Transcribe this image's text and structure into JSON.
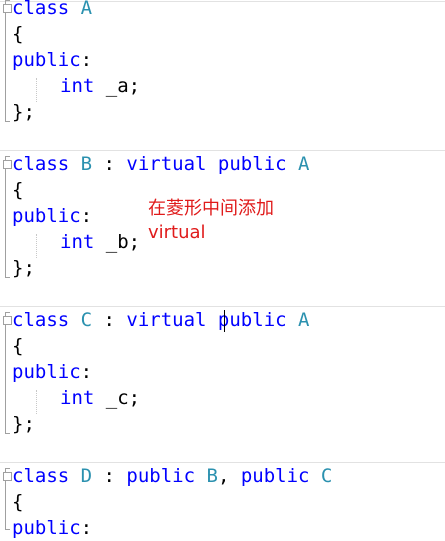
{
  "editor": {
    "lines": [
      {
        "parts": [
          {
            "t": "class ",
            "c": "kw"
          },
          {
            "t": "A",
            "c": "ty"
          }
        ]
      },
      {
        "parts": [
          {
            "t": "{",
            "c": ""
          }
        ]
      },
      {
        "parts": [
          {
            "t": "public",
            "c": "kw"
          },
          {
            "t": ":",
            "c": ""
          }
        ]
      },
      {
        "indent": true,
        "parts": [
          {
            "t": "int",
            "c": "kw"
          },
          {
            "t": " _a;",
            "c": ""
          }
        ]
      },
      {
        "parts": [
          {
            "t": "};",
            "c": ""
          }
        ]
      },
      {
        "parts": []
      },
      {
        "parts": [
          {
            "t": "class ",
            "c": "kw"
          },
          {
            "t": "B",
            "c": "ty"
          },
          {
            "t": " : ",
            "c": ""
          },
          {
            "t": "virtual public ",
            "c": "kw"
          },
          {
            "t": "A",
            "c": "ty"
          }
        ]
      },
      {
        "parts": [
          {
            "t": "{",
            "c": ""
          }
        ]
      },
      {
        "parts": [
          {
            "t": "public",
            "c": "kw"
          },
          {
            "t": ":",
            "c": ""
          }
        ]
      },
      {
        "indent": true,
        "parts": [
          {
            "t": "int",
            "c": "kw"
          },
          {
            "t": " _b;",
            "c": ""
          }
        ]
      },
      {
        "parts": [
          {
            "t": "};",
            "c": ""
          }
        ]
      },
      {
        "parts": []
      },
      {
        "parts": [
          {
            "t": "class ",
            "c": "kw"
          },
          {
            "t": "C",
            "c": "ty"
          },
          {
            "t": " : ",
            "c": ""
          },
          {
            "t": "virtual public ",
            "c": "kw"
          },
          {
            "t": "A",
            "c": "ty"
          }
        ]
      },
      {
        "parts": [
          {
            "t": "{",
            "c": ""
          }
        ]
      },
      {
        "parts": [
          {
            "t": "public",
            "c": "kw"
          },
          {
            "t": ":",
            "c": ""
          }
        ]
      },
      {
        "indent": true,
        "parts": [
          {
            "t": "int",
            "c": "kw"
          },
          {
            "t": " _c;",
            "c": ""
          }
        ]
      },
      {
        "parts": [
          {
            "t": "};",
            "c": ""
          }
        ]
      },
      {
        "parts": []
      },
      {
        "parts": [
          {
            "t": "class ",
            "c": "kw"
          },
          {
            "t": "D",
            "c": "ty"
          },
          {
            "t": " : ",
            "c": ""
          },
          {
            "t": "public ",
            "c": "kw"
          },
          {
            "t": "B",
            "c": "ty"
          },
          {
            "t": ", ",
            "c": ""
          },
          {
            "t": "public ",
            "c": "kw"
          },
          {
            "t": "C",
            "c": "ty"
          }
        ]
      },
      {
        "parts": [
          {
            "t": "{",
            "c": ""
          }
        ]
      },
      {
        "parts": [
          {
            "t": "public",
            "c": "kw"
          },
          {
            "t": ":",
            "c": ""
          }
        ]
      }
    ]
  },
  "annotation": {
    "line1": "在菱形中间添加",
    "line2": "virtual"
  },
  "colors": {
    "keyword": "#0000ff",
    "type": "#2b91af",
    "annotation": "#e01b1b"
  }
}
